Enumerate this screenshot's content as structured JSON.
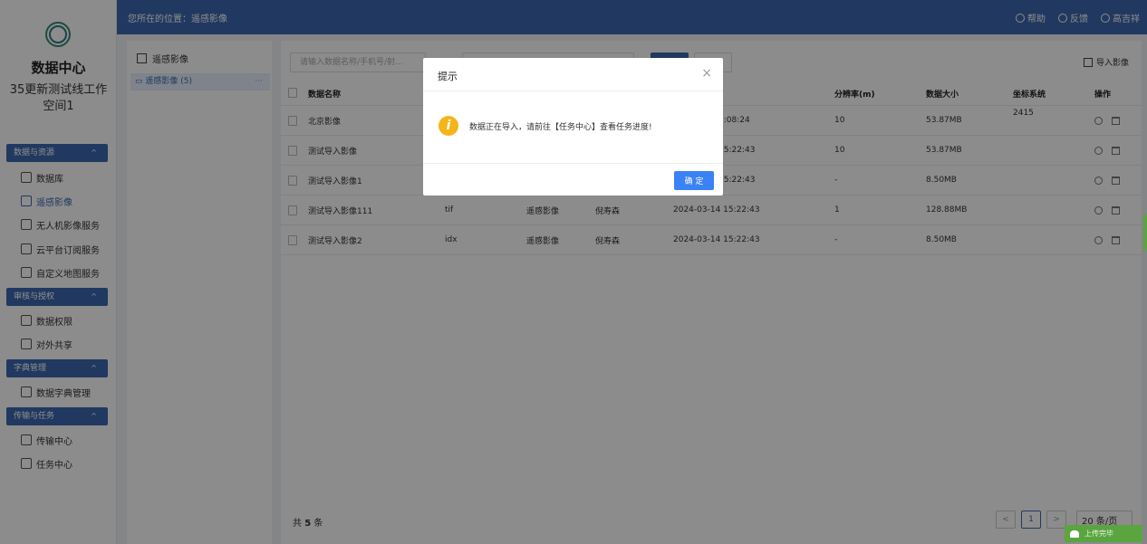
{
  "sidebar": {
    "title": "数据中心",
    "workspace": "35更新测试线工作空间1",
    "groups": [
      {
        "label": "数据与资源",
        "items": [
          {
            "label": "数据库",
            "icon": "table-icon"
          },
          {
            "label": "遥感影像",
            "icon": "image-icon"
          },
          {
            "label": "无人机影像服务",
            "icon": "drone-icon"
          },
          {
            "label": "云平台订阅服务",
            "icon": "cloud-icon"
          },
          {
            "label": "自定义地图服务",
            "icon": "map-icon"
          }
        ]
      },
      {
        "label": "审核与授权",
        "items": [
          {
            "label": "数据权限",
            "icon": "shield-icon"
          },
          {
            "label": "对外共享",
            "icon": "share-icon"
          }
        ]
      },
      {
        "label": "字典管理",
        "items": [
          {
            "label": "数据字典管理",
            "icon": "dictionary-icon"
          }
        ]
      },
      {
        "label": "传输与任务",
        "items": [
          {
            "label": "传输中心",
            "icon": "transfer-icon"
          },
          {
            "label": "任务中心",
            "icon": "task-icon"
          }
        ]
      }
    ]
  },
  "topbar": {
    "breadcrumb": "您所在的位置：遥感影像",
    "help": "帮助",
    "feedback": "反馈",
    "user": "高吉祥"
  },
  "tree": {
    "root": "遥感影像",
    "child": "遥感影像 (5)",
    "more": "···"
  },
  "toolbar": {
    "search_placeholder": "请输入数据名称/手机号/射...",
    "import_label": "导入影像"
  },
  "table": {
    "headers": {
      "name": "数据名称",
      "resolution": "分辨率(m)",
      "size": "数据大小",
      "crs": "坐标系统",
      "ops": "操作"
    },
    "rows": [
      {
        "name": "北京影像",
        "format": "",
        "type": "",
        "user": "",
        "time": "7:08:24",
        "resolution": "10",
        "size": "53.87MB",
        "crs": "2415"
      },
      {
        "name": "测试导入影像",
        "format": "",
        "type": "",
        "user": "",
        "time": "15:22:43",
        "resolution": "10",
        "size": "53.87MB",
        "crs": ""
      },
      {
        "name": "测试导入影像1",
        "format": "",
        "type": "",
        "user": "",
        "time": "15:22:43",
        "resolution": "-",
        "size": "8.50MB",
        "crs": ""
      },
      {
        "name": "测试导入影像111",
        "format": "tif",
        "type": "遥感影像",
        "user": "倪寿森",
        "time": "2024-03-14 15:22:43",
        "resolution": "1",
        "size": "128.88MB",
        "crs": ""
      },
      {
        "name": "测试导入影像2",
        "format": "idx",
        "type": "遥感影像",
        "user": "倪寿森",
        "time": "2024-03-14 15:22:43",
        "resolution": "-",
        "size": "8.50MB",
        "crs": ""
      }
    ]
  },
  "footer": {
    "total_prefix": "共",
    "total_count": "5",
    "total_suffix": "条",
    "prev": "<",
    "page": "1",
    "next": ">",
    "page_size": "20 条/页"
  },
  "upload": {
    "label": "上传完毕"
  },
  "dialog": {
    "title": "提示",
    "close": "×",
    "icon_glyph": "i",
    "message": "数据正在导入，请前往【任务中心】查看任务进度!",
    "ok": "确 定"
  }
}
